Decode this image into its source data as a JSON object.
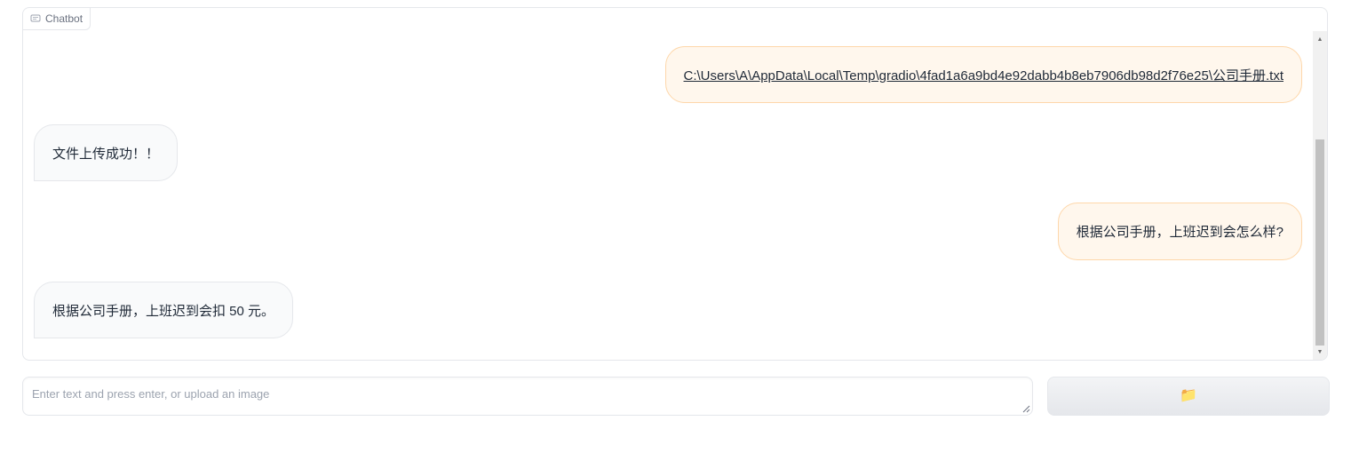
{
  "chatbot": {
    "label": "Chatbot",
    "label_icon": "chat-bubble-icon",
    "messages": [
      {
        "role": "user",
        "text": "C:\\Users\\A\\AppData\\Local\\Temp\\gradio\\4fad1a6a9bd4e92dabb4b8eb7906db98d2f76e25\\公司手册.txt",
        "is_link": true
      },
      {
        "role": "bot",
        "text": "文件上传成功！！"
      },
      {
        "role": "user",
        "text": "根据公司手册，上班迟到会怎么样?"
      },
      {
        "role": "bot",
        "text": "根据公司手册，上班迟到会扣 50 元。"
      }
    ]
  },
  "input": {
    "placeholder": "Enter text and press enter, or upload an image",
    "value": ""
  },
  "upload_button": {
    "icon": "folder-icon",
    "glyph": "📁"
  },
  "colors": {
    "user_bubble": "#fff7ed",
    "user_border": "#fed7aa",
    "bot_bubble": "#f9fafb",
    "border": "#e5e7eb"
  }
}
